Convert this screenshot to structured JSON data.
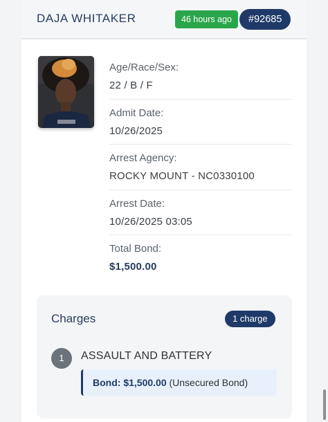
{
  "header": {
    "name": "DAJA WHITAKER",
    "time_ago": "46 hours ago",
    "booking_id": "#92685"
  },
  "details": [
    {
      "label": "Age/Race/Sex:",
      "value": "22 / B / F"
    },
    {
      "label": "Admit Date:",
      "value": "10/26/2025"
    },
    {
      "label": "Arrest Agency:",
      "value": "ROCKY MOUNT - NC0330100"
    },
    {
      "label": "Arrest Date:",
      "value": "10/26/2025 03:05"
    },
    {
      "label": "Total Bond:",
      "value": "$1,500.00"
    }
  ],
  "charges": {
    "title": "Charges",
    "count_label": "1 charge",
    "items": [
      {
        "number": "1",
        "name": "ASSAULT AND BATTERY",
        "bond_label": "Bond: $1,500.00",
        "bond_type": "(Unsecured Bond)"
      }
    ]
  },
  "colors": {
    "navy": "#1f3a68",
    "green_badge": "#2aa64a",
    "bond_box": "#e8f1fb"
  }
}
